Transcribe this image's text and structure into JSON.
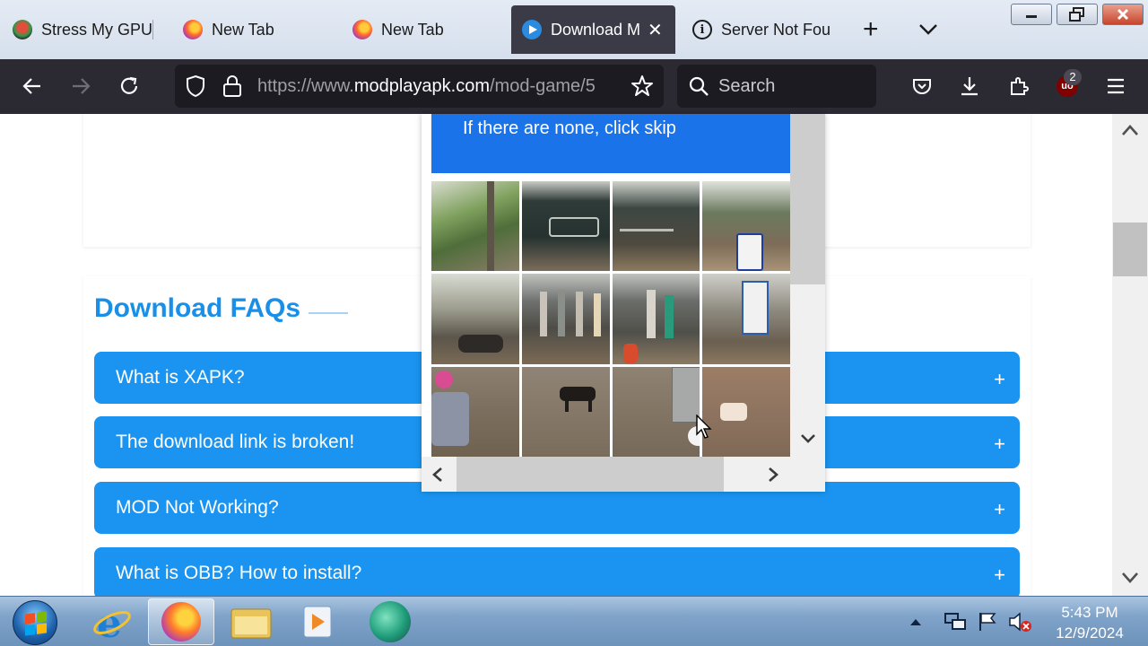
{
  "browser": {
    "tabs": [
      {
        "title": "Stress My GPU",
        "icon": "gpu-icon",
        "active": false
      },
      {
        "title": "New Tab",
        "icon": "firefox-icon",
        "active": false
      },
      {
        "title": "New Tab",
        "icon": "firefox-icon",
        "active": false
      },
      {
        "title": "Download M",
        "icon": "play-icon",
        "active": true
      },
      {
        "title": "Server Not Fou",
        "icon": "info-icon",
        "active": false
      }
    ],
    "new_tab_label": "+",
    "url": {
      "prefix": "https://www.",
      "host": "modplayapk.com",
      "path": "/mod-game/5"
    },
    "search_placeholder": "Search",
    "extension_badge": "2",
    "extension_label": "uo"
  },
  "page": {
    "faq_title": "Download FAQs",
    "faq_items": [
      {
        "question": "What is XAPK?",
        "expand": "+"
      },
      {
        "question": "The download link is broken!",
        "expand": "+"
      },
      {
        "question": "MOD Not Working?",
        "expand": "+"
      },
      {
        "question": "What is OBB? How to install?",
        "expand": "+"
      }
    ]
  },
  "captcha": {
    "instruction": "If there are none, click skip",
    "tiles": [
      "tree-pole",
      "shop-sign",
      "storefront",
      "bus-stop",
      "motorbikes",
      "mannequins",
      "mannequins-child",
      "street-sign",
      "person-helmet",
      "dog",
      "street-cart",
      "road"
    ]
  },
  "taskbar": {
    "time": "5:43 PM",
    "date": "12/9/2024"
  },
  "colors": {
    "faq_blue": "#1a94f0",
    "faq_title_blue": "#1a8fe8",
    "captcha_blue": "#1a73e8",
    "toolbar_dark": "#2b2a33"
  }
}
